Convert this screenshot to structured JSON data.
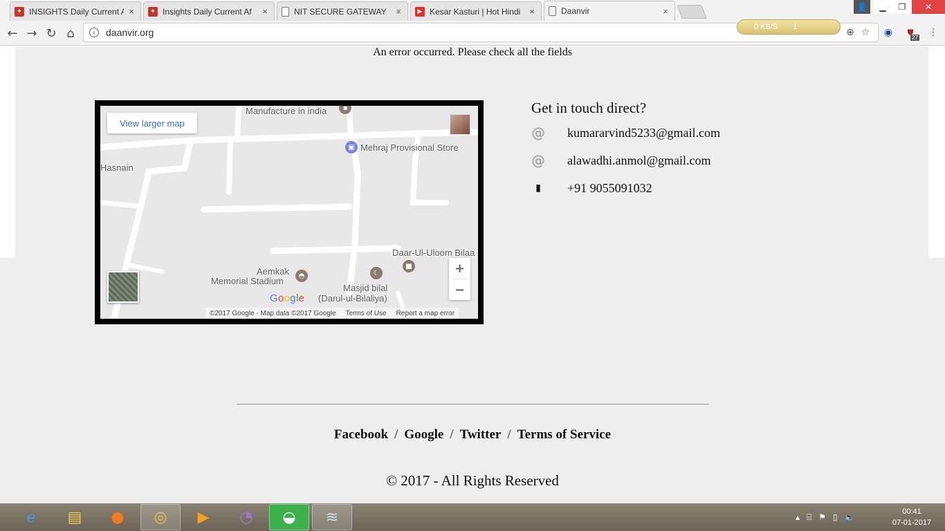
{
  "browser": {
    "tabs": [
      {
        "title": "INSIGHTS Daily Current A",
        "icon": "insights-favicon",
        "active": false
      },
      {
        "title": "Insights Daily Current Af",
        "icon": "insights-favicon",
        "active": false
      },
      {
        "title": "NIT SECURE GATEWAY",
        "icon": "document-icon",
        "active": false
      },
      {
        "title": "Kesar Kasturi | Hot Hindi",
        "icon": "youtube-icon",
        "active": false
      },
      {
        "title": "Daanvir",
        "icon": "document-icon",
        "active": true
      }
    ],
    "close_glyph": "×",
    "url": "daanvir.org",
    "net_speed": "0 KB/S",
    "net_count": "1",
    "extension_badge": "27"
  },
  "page": {
    "error_message": "An error occurred. Please check all the fields",
    "map": {
      "view_larger": "View larger map",
      "labels": {
        "manufacture": "Manufacture in india",
        "mehraj": "Mehraj Provisional Store",
        "hasnain": "Hasnain",
        "daar": "Daar-Ul-Uloom Bilaa",
        "aemkak_1": "Aemkak",
        "aemkak_2": "Memorial Stadium",
        "masjid_1": "Masjid bilal",
        "masjid_2": "(Darul-ul-Bilaliya)"
      },
      "zoom_in": "+",
      "zoom_out": "−",
      "logo": "Google",
      "footer": {
        "copyright": "©2017 Google - Map data ©2017 Google",
        "terms": "Terms of Use",
        "report": "Report a map error"
      }
    },
    "contact": {
      "title": "Get in touch direct?",
      "email1": "kumararvind5233@gmail.com",
      "email2": "alawadhi.anmol@gmail.com",
      "phone": "+91 9055091032",
      "at_glyph": "@",
      "phone_glyph": "▮"
    },
    "footer": {
      "links": [
        "Facebook",
        "Google",
        "Twitter",
        "Terms of Service"
      ],
      "separator": "/",
      "copyright": "© 2017 - All Rights Reserved"
    }
  },
  "taskbar": {
    "apps": [
      "internet-explorer-icon",
      "file-explorer-icon",
      "firefox-icon",
      "chrome-icon",
      "media-player-icon",
      "torrent-icon",
      "eagle-browser-icon",
      "network-app-icon"
    ],
    "time": "00:41",
    "date": "07-01-2017"
  }
}
